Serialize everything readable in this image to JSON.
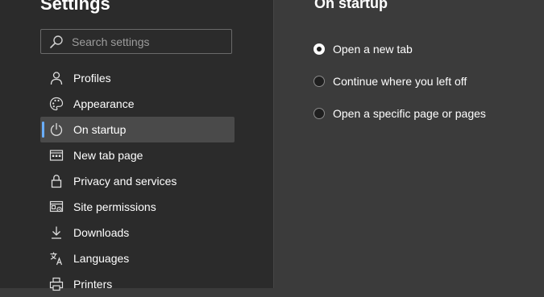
{
  "sidebar": {
    "title": "Settings",
    "search_placeholder": "Search settings",
    "items": [
      {
        "label": "Profiles",
        "icon": "person-icon"
      },
      {
        "label": "Appearance",
        "icon": "palette-icon"
      },
      {
        "label": "On startup",
        "icon": "power-icon",
        "active": true
      },
      {
        "label": "New tab page",
        "icon": "new-tab-icon"
      },
      {
        "label": "Privacy and services",
        "icon": "lock-icon"
      },
      {
        "label": "Site permissions",
        "icon": "site-permissions-icon"
      },
      {
        "label": "Downloads",
        "icon": "download-icon"
      },
      {
        "label": "Languages",
        "icon": "language-icon"
      },
      {
        "label": "Printers",
        "icon": "printer-icon"
      }
    ]
  },
  "main": {
    "title": "On startup",
    "options": [
      {
        "label": "Open a new tab",
        "selected": true
      },
      {
        "label": "Continue where you left off",
        "selected": false
      },
      {
        "label": "Open a specific page or pages",
        "selected": false
      }
    ]
  },
  "colors": {
    "accent": "#6aaeff",
    "sidebar_bg": "#2b2b2b",
    "main_bg": "#3b3b3b",
    "active_item_bg": "#4a4a4a"
  }
}
